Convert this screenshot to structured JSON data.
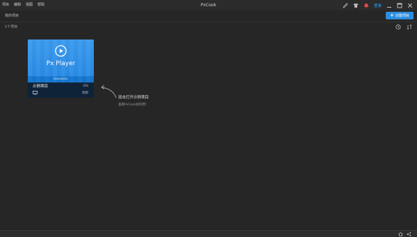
{
  "menu": {
    "items": [
      "项目",
      "编辑",
      "视图",
      "帮助"
    ]
  },
  "app": {
    "title": "PxCook"
  },
  "titlebar": {
    "login_label": "登录"
  },
  "page": {
    "title": "我的项目",
    "new_project_label": "创建项目",
    "project_count": "1个项目"
  },
  "card": {
    "product": "Px Player",
    "brand": "Ueimenic",
    "name": "示例项目",
    "platform": "iOS",
    "time": "刚刚"
  },
  "hint": {
    "title": "双击打开示例项目",
    "subtitle": "查看PxCook如何用!"
  },
  "colors": {
    "accent": "#2b8ddf",
    "card_blue": "#2789e4",
    "card_info": "#0e2338",
    "background": "#262626"
  }
}
